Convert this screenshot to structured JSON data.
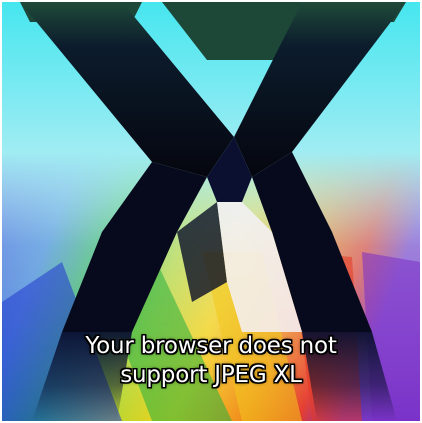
{
  "image": {
    "caption_line1": "Your browser does not",
    "caption_line2": "support JPEG XL",
    "colors": {
      "top": "#4fe9ee",
      "pale": "#d8f4f8",
      "letter_dark": "#0c1330",
      "stripe_red": "#e53a2a",
      "stripe_yellow": "#f5d21b",
      "stripe_green": "#2fb84a",
      "stripe_blue": "#2b45d9",
      "stripe_purple": "#7a36c9"
    }
  }
}
